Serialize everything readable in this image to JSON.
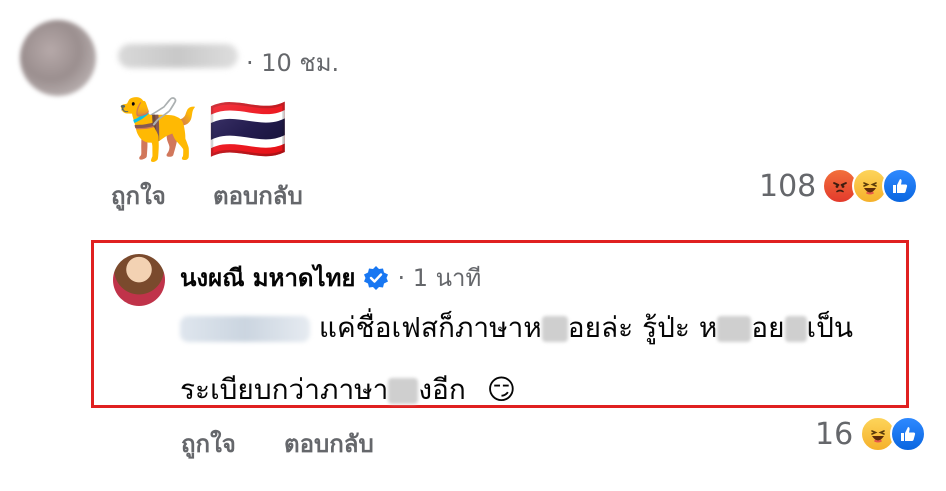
{
  "comment": {
    "time": "· 10 ชม.",
    "emojis": [
      "🦮",
      "🇹🇭"
    ],
    "actions": {
      "like": "ถูกใจ",
      "reply": "ตอบกลับ"
    },
    "reaction_count": "108",
    "reactions": [
      "angry-reaction-icon",
      "haha-reaction-icon",
      "like-reaction-icon"
    ]
  },
  "reply": {
    "author": "นงผณี มหาดไทย",
    "verified_icon": "verified-badge-icon",
    "time": "· 1 นาที",
    "text_line1_a": "แค่ชื่อเฟสก็ภาษาห",
    "text_line1_b": "อยล่ะ รู้ป่ะ ห",
    "text_line1_c": "อย",
    "text_line1_d": "เป็น",
    "text_line2_a": "ระเบียบกว่าภาษา",
    "text_line2_b": "งอีก",
    "emoji": "😏",
    "actions": {
      "like": "ถูกใจ",
      "reply": "ตอบกลับ"
    },
    "reaction_count": "16",
    "reactions": [
      "haha-reaction-icon",
      "like-reaction-icon"
    ]
  },
  "colors": {
    "highlight": "#e02020",
    "verified": "#1877f2",
    "meta": "#65676b"
  }
}
